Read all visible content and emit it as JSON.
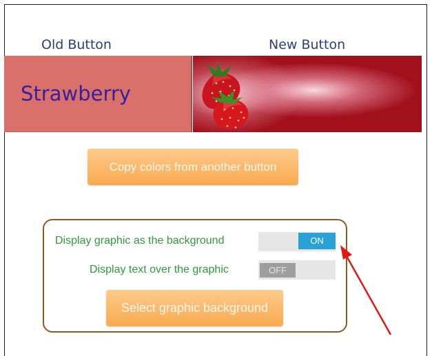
{
  "headers": {
    "old_button": "Old Button",
    "new_button": "New Button"
  },
  "old_button": {
    "label": "Strawberry",
    "background_color": "#d9706c",
    "text_color": "#3a1f9a"
  },
  "new_button": {
    "graphic": "strawberry-image",
    "background_color": "#a2101c"
  },
  "copy_colors_button": {
    "label": "Copy colors from another button"
  },
  "options": {
    "display_graphic_background": {
      "label": "Display graphic as the background",
      "state": "ON"
    },
    "display_text_over_graphic": {
      "label": "Display text over the graphic",
      "state": "OFF"
    }
  },
  "select_graphic_button": {
    "label": "Select graphic background"
  },
  "colors": {
    "header_text": "#2a3f78",
    "option_label": "#2f9a3a",
    "toggle_on": "#2aa2d8",
    "toggle_off": "#9e9e9e",
    "action_button": "#f9a94e",
    "panel_border": "#8b5a20",
    "annotation_arrow": "#e01818"
  }
}
